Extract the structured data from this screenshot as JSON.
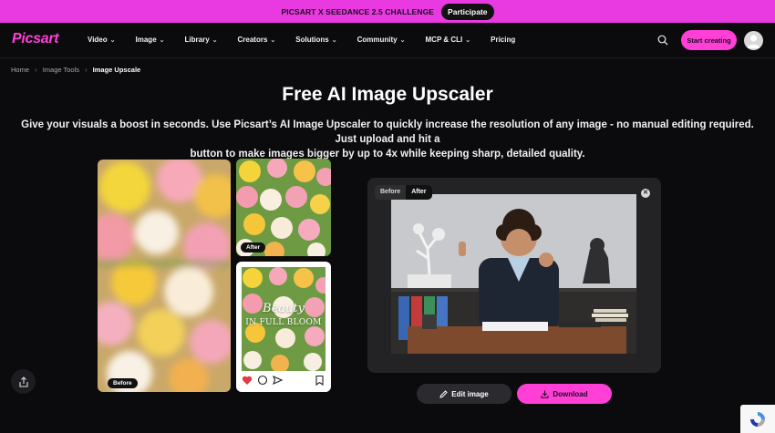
{
  "promo": {
    "text": "PICSART X SEEDANCE 2.5 CHALLENGE",
    "button": "Participate"
  },
  "nav": {
    "logo": "Picsart",
    "items": [
      {
        "label": "Video",
        "chevron": true
      },
      {
        "label": "Image",
        "chevron": true
      },
      {
        "label": "Library",
        "chevron": true
      },
      {
        "label": "Creators",
        "chevron": true
      },
      {
        "label": "Solutions",
        "chevron": true
      },
      {
        "label": "Community",
        "chevron": true
      },
      {
        "label": "MCP & CLI",
        "chevron": true
      },
      {
        "label": "Pricing",
        "chevron": false
      }
    ],
    "search_icon": "search-icon",
    "cta": "Start creating"
  },
  "breadcrumb": {
    "home": "Home",
    "tools": "Image Tools",
    "current": "Image Upscale"
  },
  "hero": {
    "title": "Free AI Image Upscaler",
    "description_line1": "Give your visuals a boost in seconds. Use Picsart’s AI Image Upscaler to quickly increase the resolution of any image - no manual editing required. Just upload and hit a",
    "description_line2": "button to make images bigger by up to 4x while keeping sharp, detailed quality."
  },
  "examples": {
    "before_label": "Before",
    "after_label": "After",
    "post_title_line1": "Beauty",
    "post_title_line2": "IN FULL BLOOM"
  },
  "compare": {
    "before": "Before",
    "after": "After",
    "active": "After"
  },
  "actions": {
    "edit": "Edit image",
    "download": "Download"
  },
  "colors": {
    "accent": "#ff3fd6",
    "promo": "#e83ae0",
    "bg": "#0b0b0d"
  }
}
